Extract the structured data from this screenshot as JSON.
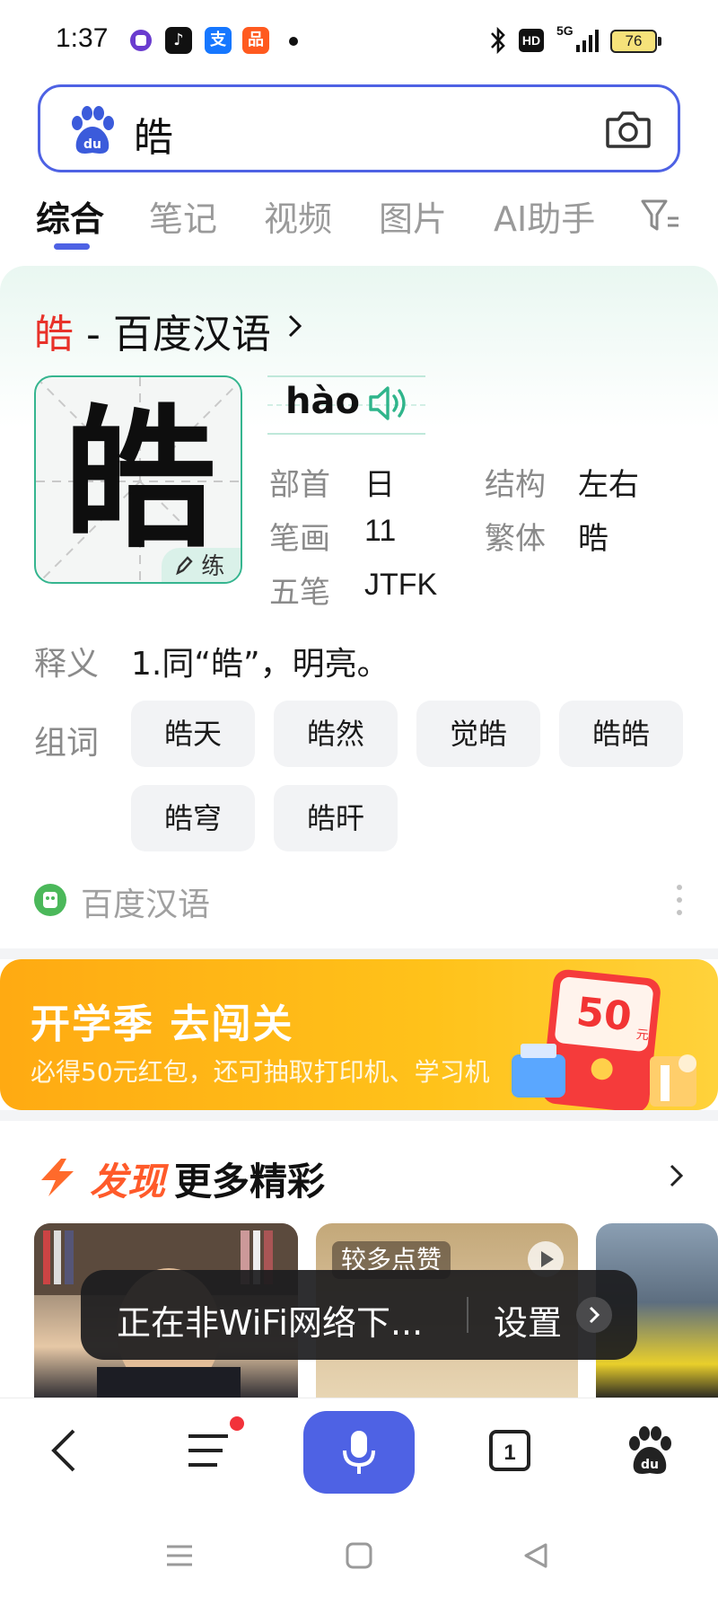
{
  "status_bar": {
    "time": "1:37",
    "apps": [
      {
        "icon": "purple-circle-app-icon",
        "label": ""
      },
      {
        "icon": "tiktok-icon",
        "label": "♪"
      },
      {
        "icon": "alipay-icon",
        "label": "支"
      },
      {
        "icon": "taobao-icon",
        "label": "品"
      }
    ],
    "network": "5G",
    "hd_badge": "HD",
    "battery": "76"
  },
  "search": {
    "query": "皓"
  },
  "tabs": [
    {
      "label": "综合",
      "active": true
    },
    {
      "label": "笔记",
      "active": false
    },
    {
      "label": "视频",
      "active": false
    },
    {
      "label": "图片",
      "active": false
    },
    {
      "label": "AI助手",
      "active": false
    }
  ],
  "dictionary": {
    "title_char": "皓",
    "title_source": " - 百度汉语",
    "character": "皓",
    "practice_label": "练",
    "pinyin": "hào",
    "info": [
      {
        "label": "部首",
        "value": "日"
      },
      {
        "label": "结构",
        "value": "左右"
      },
      {
        "label": "笔画",
        "value": "11"
      },
      {
        "label": "繁体",
        "value": "晧"
      },
      {
        "label": "五笔",
        "value": "JTFK"
      }
    ],
    "meaning_label": "释义",
    "meaning": "1.同“皓”，明亮。",
    "words_label": "组词",
    "words": [
      "皓天",
      "皓然",
      "觉皓",
      "皓皓",
      "皓穹",
      "皓旰"
    ],
    "source": "百度汉语"
  },
  "promo": {
    "title": "开学季  去闯关",
    "subtitle": "必得50元红包，还可抽取打印机、学习机",
    "art_value": "50",
    "art_unit": "元"
  },
  "discover": {
    "label": "发现",
    "more": "更多精彩",
    "thumb_badge": "较多点赞"
  },
  "toast": {
    "text": "正在非WiFi网络下...",
    "action": "设置"
  },
  "bottom_bar": {
    "tab_count": "1"
  },
  "colors": {
    "accent": "#4e62e4",
    "highlight": "#e8322a",
    "teal": "#35b58f",
    "promo": "#ffb21a",
    "discover": "#ff5a2a"
  }
}
